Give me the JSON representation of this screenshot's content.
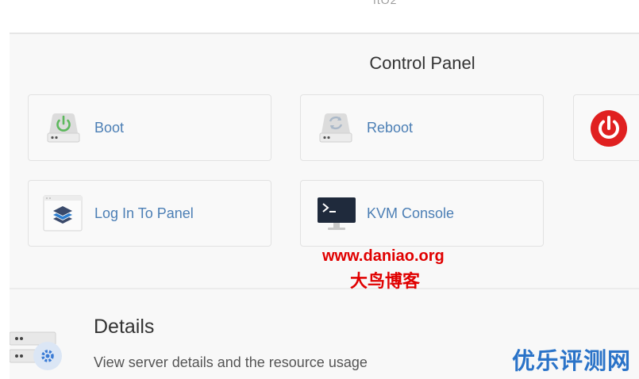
{
  "header": {
    "cut_text": "ftO2"
  },
  "control_panel": {
    "title": "Control Panel",
    "tiles": [
      {
        "label": "Boot",
        "icon": "power-drive-icon"
      },
      {
        "label": "Reboot",
        "icon": "refresh-drive-icon"
      },
      {
        "label": "",
        "icon": "power-off-icon"
      },
      {
        "label": "Log In To Panel",
        "icon": "layers-window-icon"
      },
      {
        "label": "KVM Console",
        "icon": "terminal-monitor-icon"
      }
    ]
  },
  "details": {
    "title": "Details",
    "description": "View server details and the resource usage",
    "icon": "server-settings-icon"
  },
  "watermarks": {
    "url": "www.daniao.org",
    "cn_name": "大鸟博客",
    "corner": "优乐评测网"
  },
  "colors": {
    "accent_link": "#4c7fb5",
    "power_red": "#e02020",
    "watermark_red": "#e00000",
    "watermark_blue": "#2a73c8"
  }
}
